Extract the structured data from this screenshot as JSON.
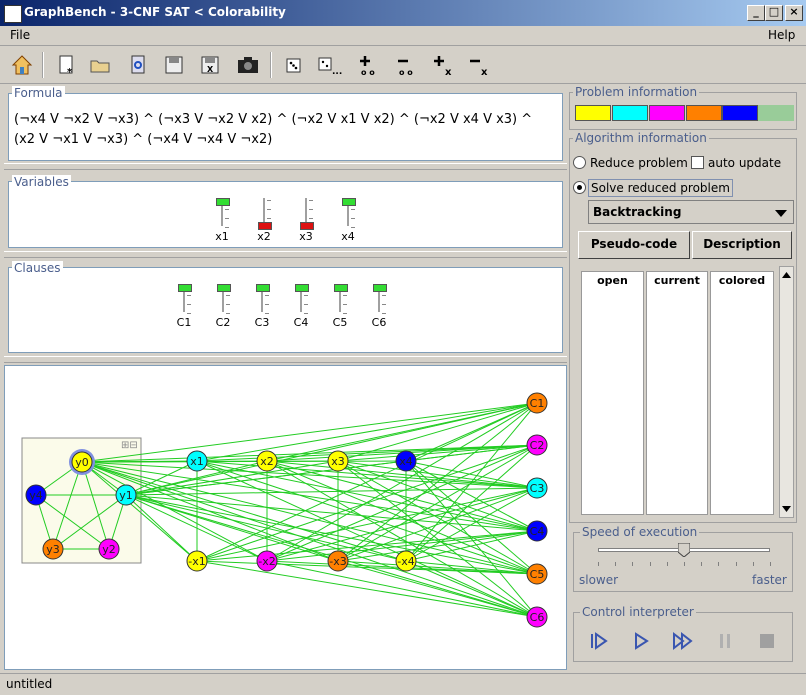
{
  "window": {
    "title": "GraphBench - 3-CNF SAT < Colorability",
    "min": "_",
    "max": "□",
    "close": "×"
  },
  "menu": {
    "file": "File",
    "help": "Help"
  },
  "formula": {
    "legend": "Formula",
    "text": "(¬x4 V ¬x2 V ¬x3) ^ (¬x3 V ¬x2 V x2) ^ (¬x2 V x1 V x2) ^ (¬x2 V x4 V x3) ^ (x2 V ¬x1 V ¬x3) ^ (¬x4 V ¬x4 V ¬x2)"
  },
  "variables": {
    "legend": "Variables",
    "items": [
      {
        "label": "x1",
        "state": "true"
      },
      {
        "label": "x2",
        "state": "false"
      },
      {
        "label": "x3",
        "state": "false"
      },
      {
        "label": "x4",
        "state": "true"
      }
    ]
  },
  "clauses": {
    "legend": "Clauses",
    "items": [
      {
        "label": "C1"
      },
      {
        "label": "C2"
      },
      {
        "label": "C3"
      },
      {
        "label": "C4"
      },
      {
        "label": "C5"
      },
      {
        "label": "C6"
      }
    ]
  },
  "colors": {
    "true": "#33dd33",
    "false": "#dd1111",
    "yellow": "#ffff00",
    "cyan": "#00ffff",
    "magenta": "#ff00ff",
    "orange": "#ff8000",
    "blue": "#0000ff",
    "sage": "#99cc99",
    "edge": "#22cc22"
  },
  "graph": {
    "nodes": [
      {
        "id": "y0",
        "label": "y0",
        "color": "yellow"
      },
      {
        "id": "y1",
        "label": "y1",
        "color": "cyan"
      },
      {
        "id": "y4",
        "label": "y4",
        "color": "blue"
      },
      {
        "id": "y3",
        "label": "y3",
        "color": "orange"
      },
      {
        "id": "y2",
        "label": "y2",
        "color": "magenta"
      },
      {
        "id": "x1",
        "label": "x1",
        "color": "cyan"
      },
      {
        "id": "x2",
        "label": "x2",
        "color": "yellow"
      },
      {
        "id": "x3",
        "label": "x3",
        "color": "yellow"
      },
      {
        "id": "x4",
        "label": "x4",
        "color": "blue"
      },
      {
        "id": "nx1",
        "label": "-x1",
        "color": "yellow"
      },
      {
        "id": "nx2",
        "label": "-x2",
        "color": "magenta"
      },
      {
        "id": "nx3",
        "label": "-x3",
        "color": "orange"
      },
      {
        "id": "nx4",
        "label": "-x4",
        "color": "yellow"
      },
      {
        "id": "C1",
        "label": "C1",
        "color": "orange"
      },
      {
        "id": "C2",
        "label": "C2",
        "color": "magenta"
      },
      {
        "id": "C3",
        "label": "C3",
        "color": "cyan"
      },
      {
        "id": "C4",
        "label": "C4",
        "color": "blue"
      },
      {
        "id": "C5",
        "label": "C5",
        "color": "orange"
      },
      {
        "id": "C6",
        "label": "C6",
        "color": "magenta"
      }
    ]
  },
  "problem_info": {
    "legend": "Problem information",
    "swatches": [
      "yellow",
      "cyan",
      "magenta",
      "orange",
      "blue",
      "sage"
    ]
  },
  "algorithm_info": {
    "legend": "Algorithm information",
    "reduce": "Reduce problem",
    "auto_update": "auto update",
    "solve": "Solve reduced problem",
    "algorithm": "Backtracking",
    "pseudo": "Pseudo-code",
    "description": "Description",
    "columns": [
      "open",
      "current",
      "colored"
    ]
  },
  "speed": {
    "legend": "Speed of execution",
    "slower": "slower",
    "faster": "faster",
    "level": 0.5
  },
  "control": {
    "legend": "Control interpreter"
  },
  "status": {
    "text": "untitled"
  }
}
